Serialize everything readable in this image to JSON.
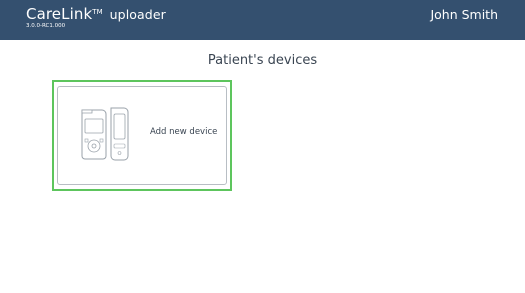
{
  "header": {
    "brand_name": "CareLink",
    "brand_mark": "TM",
    "brand_product": "uploader",
    "version": "3.0.0-RC1.000",
    "user_name": "John Smith",
    "background_color": "#34506f"
  },
  "main": {
    "title": "Patient's devices",
    "add_device_card": {
      "label": "Add new device",
      "icon": "pump-and-meter-devices-icon",
      "highlight_color": "#5dc55d"
    }
  }
}
